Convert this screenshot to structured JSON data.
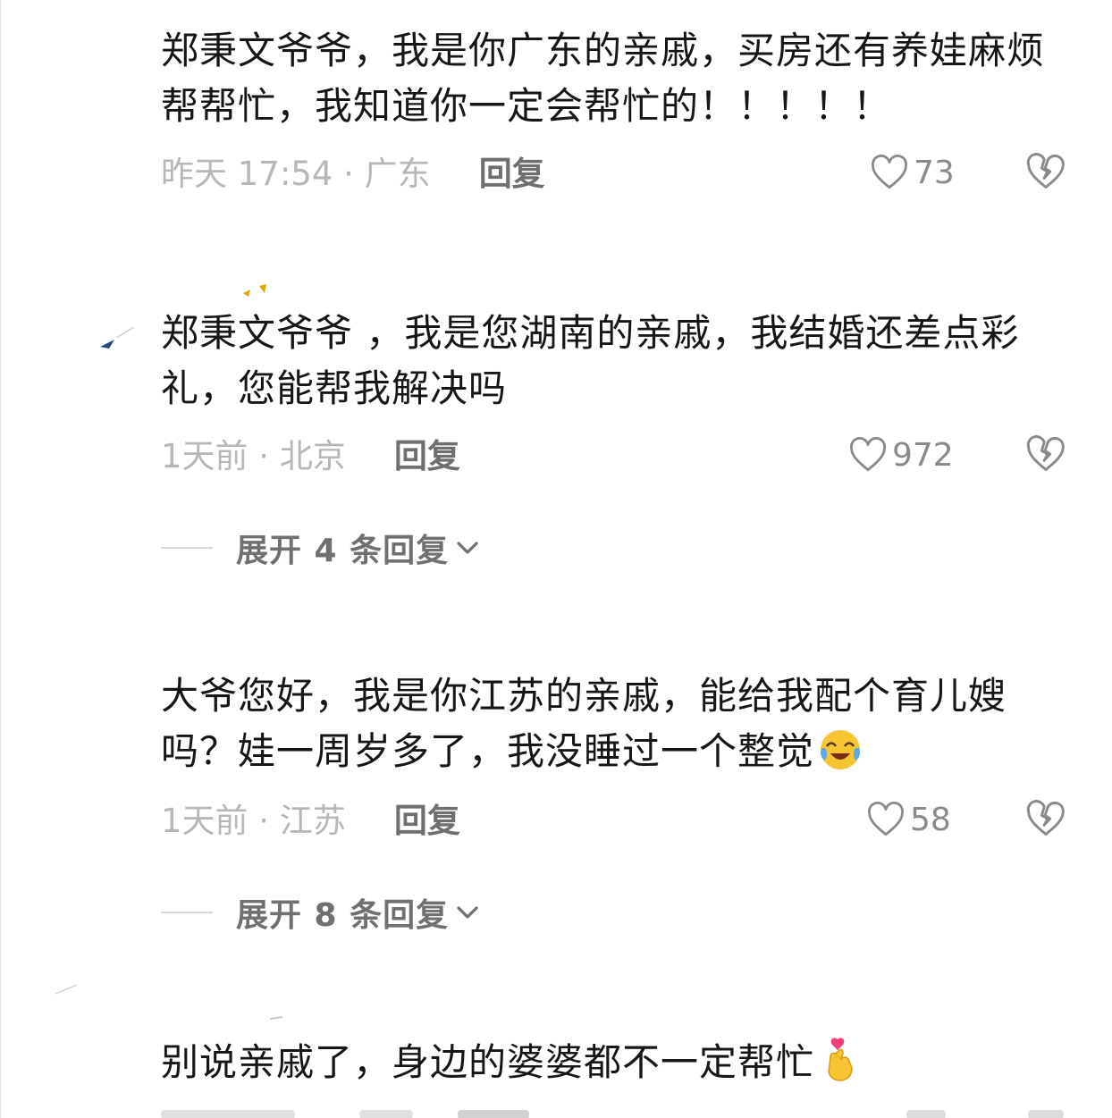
{
  "comments": [
    {
      "text": "郑秉文爷爷，我是你广东的亲戚，买房还有养娃麻烦帮帮忙，我知道你一定会帮忙的！！！！！",
      "time_location": "昨天 17:54 · 广东",
      "reply_label": "回复",
      "likes": "73",
      "expand_label": ""
    },
    {
      "text": "郑秉文爷爷 ，我是您湖南的亲戚，我结婚还差点彩礼，您能帮我解决吗",
      "time_location": "1天前 · 北京",
      "reply_label": "回复",
      "likes": "972",
      "expand_label": "展开 4 条回复"
    },
    {
      "text": "大爷您好，我是你江苏的亲戚，能给我配个育儿嫂吗？娃一周岁多了，我没睡过一个整觉",
      "time_location": "1天前 · 江苏",
      "reply_label": "回复",
      "likes": "58",
      "expand_label": "展开 8 条回复",
      "emoji": "crying-laughing-emoji"
    },
    {
      "text": "别说亲戚了，身边的婆婆都不一定帮忙",
      "emoji": "finger-heart-emoji"
    }
  ],
  "icons": {
    "like": "heart-outline-icon",
    "dislike": "broken-heart-icon",
    "expand": "chevron-down-icon"
  },
  "colors": {
    "text": "#161616",
    "meta": "#b7b7b7",
    "reply": "#6f6f6f",
    "count": "#8a8a8a",
    "emoji_yellow": "#f7c531",
    "emoji_tear": "#5aa8ee",
    "heart_pink": "#f0407a"
  }
}
